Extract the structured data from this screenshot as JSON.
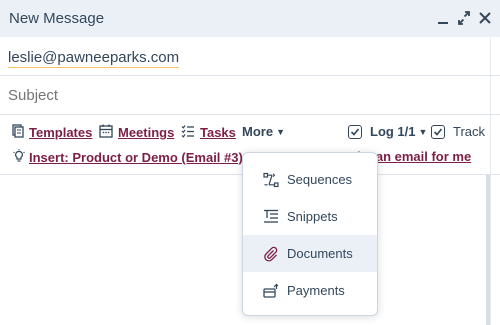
{
  "window": {
    "title": "New Message"
  },
  "to": {
    "value": "leslie@pawneeparks.com"
  },
  "subject": {
    "placeholder": "Subject"
  },
  "toolbar": {
    "templates": "Templates",
    "meetings": "Meetings",
    "tasks": "Tasks",
    "more": "More",
    "log": "Log 1/1",
    "track": "Track"
  },
  "insert": {
    "label": "Insert: Product or Demo (Email #3)",
    "partial_text": "rite an email for me"
  },
  "more_menu": {
    "items": [
      {
        "label": "Sequences",
        "icon": "sequences-icon"
      },
      {
        "label": "Snippets",
        "icon": "snippets-icon"
      },
      {
        "label": "Documents",
        "icon": "paperclip-icon",
        "hovered": true
      },
      {
        "label": "Payments",
        "icon": "payments-icon"
      }
    ]
  },
  "colors": {
    "header_bg": "#eaf0f6",
    "link": "#7c1f44",
    "text": "#33475b",
    "hover": "#eaf0f6"
  }
}
